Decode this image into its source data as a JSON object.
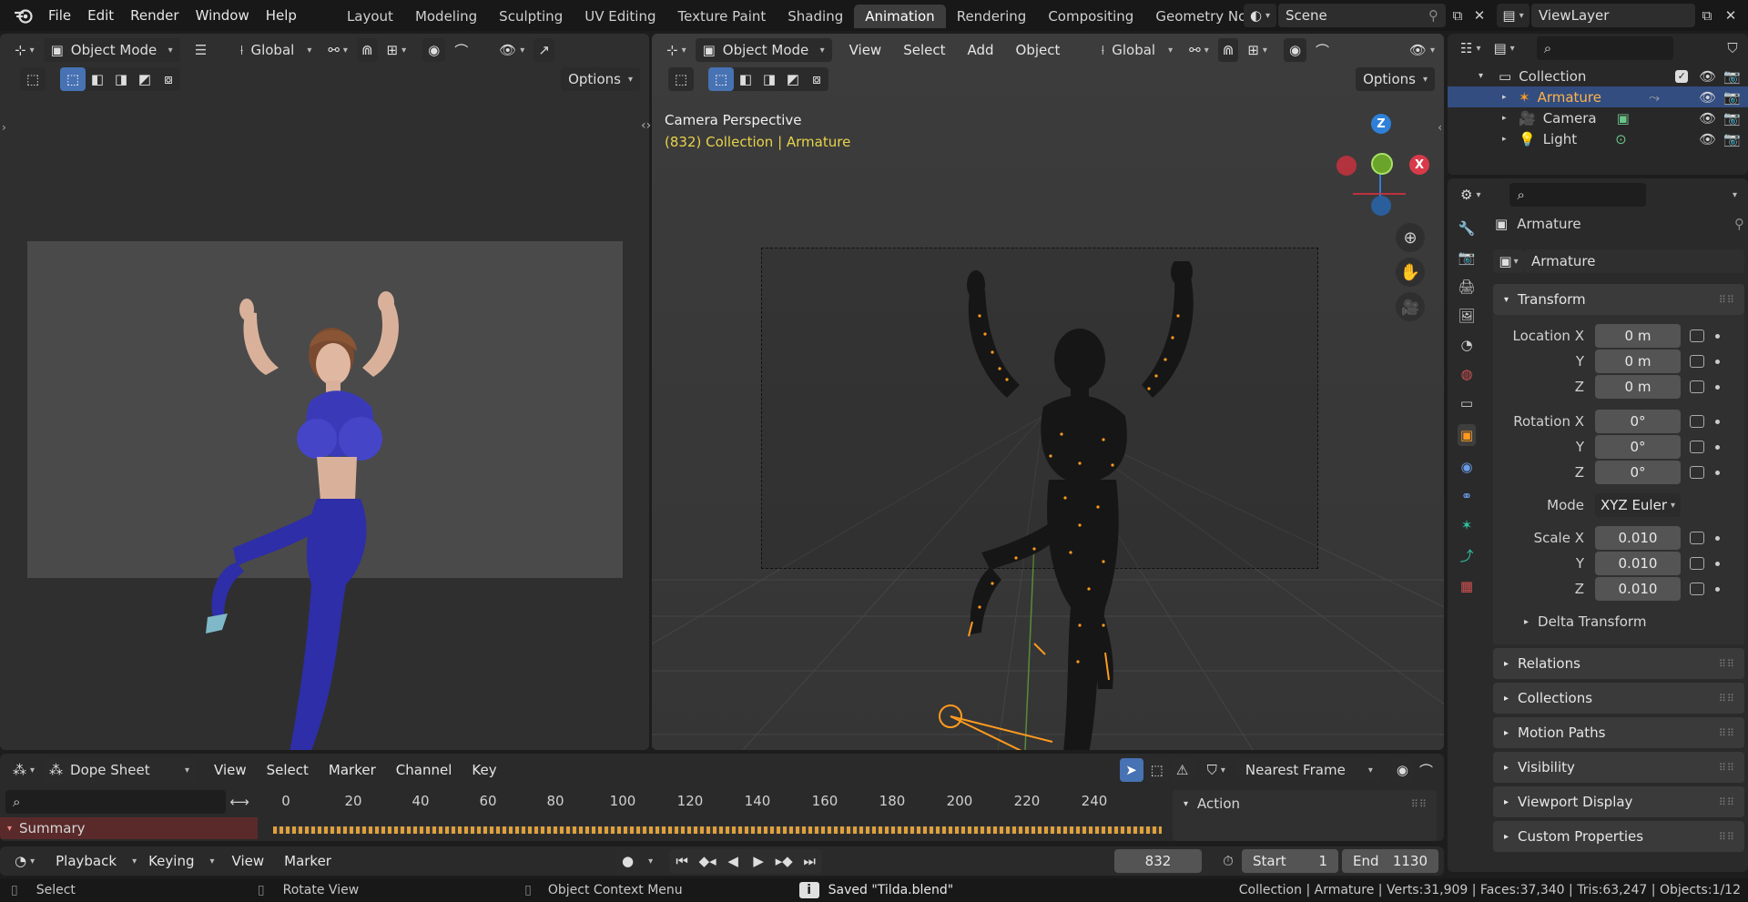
{
  "topbar": {
    "menus": [
      "File",
      "Edit",
      "Render",
      "Window",
      "Help"
    ],
    "workspaces": [
      "Layout",
      "Modeling",
      "Sculpting",
      "UV Editing",
      "Texture Paint",
      "Shading",
      "Animation",
      "Rendering",
      "Compositing",
      "Geometry Node"
    ],
    "active_workspace": "Animation",
    "scene": "Scene",
    "view_layer": "ViewLayer"
  },
  "left_view": {
    "mode": "Object Mode",
    "orientation": "Global",
    "options_label": "Options"
  },
  "viewport": {
    "mode": "Object Mode",
    "menus": [
      "View",
      "Select",
      "Add",
      "Object"
    ],
    "orientation": "Global",
    "options_label": "Options",
    "overlay_title": "Camera Perspective",
    "overlay_subtitle": "(832) Collection | Armature",
    "gizmo_z": "Z",
    "gizmo_x": "X"
  },
  "outliner": {
    "collection": "Collection",
    "items": [
      {
        "label": "Armature",
        "selected": true
      },
      {
        "label": "Camera",
        "selected": false
      },
      {
        "label": "Light",
        "selected": false
      }
    ]
  },
  "properties": {
    "object_name": "Armature",
    "data_name": "Armature",
    "transform_header": "Transform",
    "location_label": "Location X",
    "rotation_label": "Rotation X",
    "scale_label": "Scale X",
    "axis_y": "Y",
    "axis_z": "Z",
    "location": [
      "0 m",
      "0 m",
      "0 m"
    ],
    "rotation": [
      "0°",
      "0°",
      "0°"
    ],
    "mode_label": "Mode",
    "mode_value": "XYZ Euler",
    "scale": [
      "0.010",
      "0.010",
      "0.010"
    ],
    "delta": "Delta Transform",
    "sections": [
      "Relations",
      "Collections",
      "Motion Paths",
      "Visibility",
      "Viewport Display",
      "Custom Properties"
    ]
  },
  "dopesheet": {
    "editor": "Dope Sheet",
    "menus": [
      "View",
      "Select",
      "Marker",
      "Channel",
      "Key"
    ],
    "snap": "Nearest Frame",
    "summary": "Summary",
    "action_header": "Action",
    "ticks": [
      "0",
      "20",
      "40",
      "60",
      "80",
      "100",
      "120",
      "140",
      "160",
      "180",
      "200",
      "220",
      "240"
    ]
  },
  "timeline": {
    "menus": [
      "Playback",
      "Keying",
      "View",
      "Marker"
    ],
    "current_frame": "832",
    "start_label": "Start",
    "start": "1",
    "end_label": "End",
    "end": "1130"
  },
  "statusbar": {
    "select": "Select",
    "rotate": "Rotate View",
    "context": "Object Context Menu",
    "saved": "Saved \"Tilda.blend\"",
    "stats": "Collection | Armature | Verts:31,909 | Faces:37,340 | Tris:63,247 | Objects:1/12"
  },
  "colors": {
    "accent": "#4772b3",
    "selection_orange": "#ff9a1f",
    "overlay_yellow": "#e8d34a",
    "summary_bg": "#5a2a2a"
  }
}
